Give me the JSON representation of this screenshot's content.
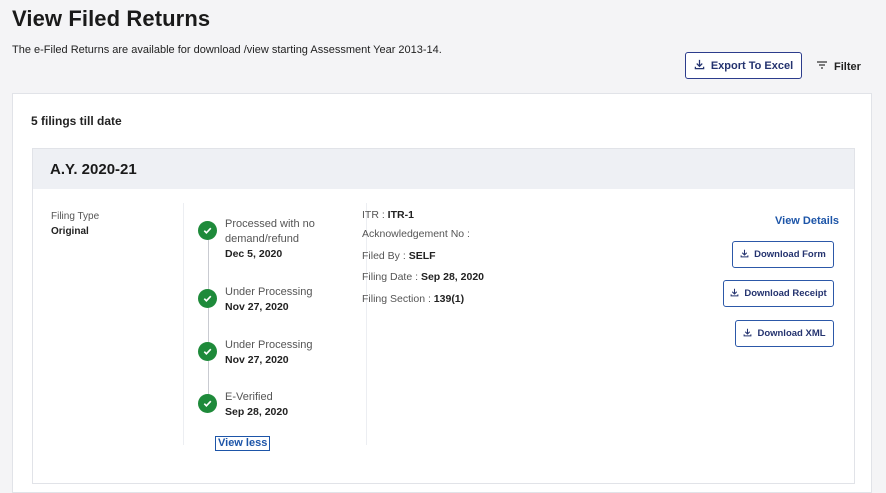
{
  "header": {
    "title": "View Filed Returns",
    "subtitle": "The e-Filed Returns are available for download /view starting Assessment Year 2013-14."
  },
  "toolbar": {
    "export_label": "Export To Excel",
    "filter_label": "Filter"
  },
  "filings": {
    "count_text": "5 filings till date",
    "year": {
      "label": "A.Y. 2020-21",
      "filing_type_label": "Filing Type",
      "filing_type_value": "Original",
      "timeline": [
        {
          "status": "Processed with no demand/refund",
          "date": "Dec 5, 2020"
        },
        {
          "status": "Under Processing",
          "date": "Nov 27, 2020"
        },
        {
          "status": "Under Processing",
          "date": "Nov 27, 2020"
        },
        {
          "status": "E-Verified",
          "date": "Sep 28, 2020"
        }
      ],
      "view_less_label": "View less",
      "details": {
        "itr_label": "ITR : ",
        "itr_value": "ITR-1",
        "ack_label": "Acknowledgement No :",
        "filed_by_label": "Filed By : ",
        "filed_by_value": "SELF",
        "filing_date_label": "Filing Date : ",
        "filing_date_value": "Sep 28, 2020",
        "filing_section_label": "Filing Section : ",
        "filing_section_value": "139(1)"
      },
      "actions": {
        "view_details": "View Details",
        "download_form": "Download Form",
        "download_receipt": "Download Receipt",
        "download_xml": "Download XML"
      }
    }
  },
  "colors": {
    "primary": "#24336f",
    "link": "#1d55a8",
    "success": "#1e8a3a",
    "header_bg": "#eef0f4"
  },
  "icons": {
    "export": "download-icon",
    "filter": "filter-icon",
    "status": "check-circle-icon"
  }
}
